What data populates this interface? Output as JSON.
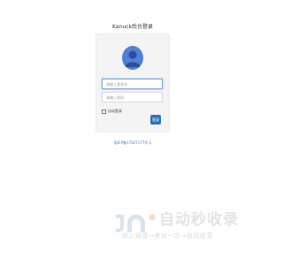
{
  "login": {
    "title": "Kanuck后台登录",
    "username_placeholder": "请输入登录名",
    "password_placeholder": "请输入密码",
    "remember_label": "自动登录",
    "login_button": "登录",
    "footer_link": "浙ICP备17027177号-1"
  },
  "watermark": {
    "brand": "自动秒收录",
    "tagline": "放上链接→来访一次→自动收录",
    "colors": {
      "logo": "#d8e3ee",
      "text": "#e2e4e6"
    }
  },
  "icons": {
    "avatar": "user-avatar-icon"
  },
  "colors": {
    "primary": "#2f73b5",
    "avatar": "#4f7fd6",
    "link": "#4a74c5"
  }
}
